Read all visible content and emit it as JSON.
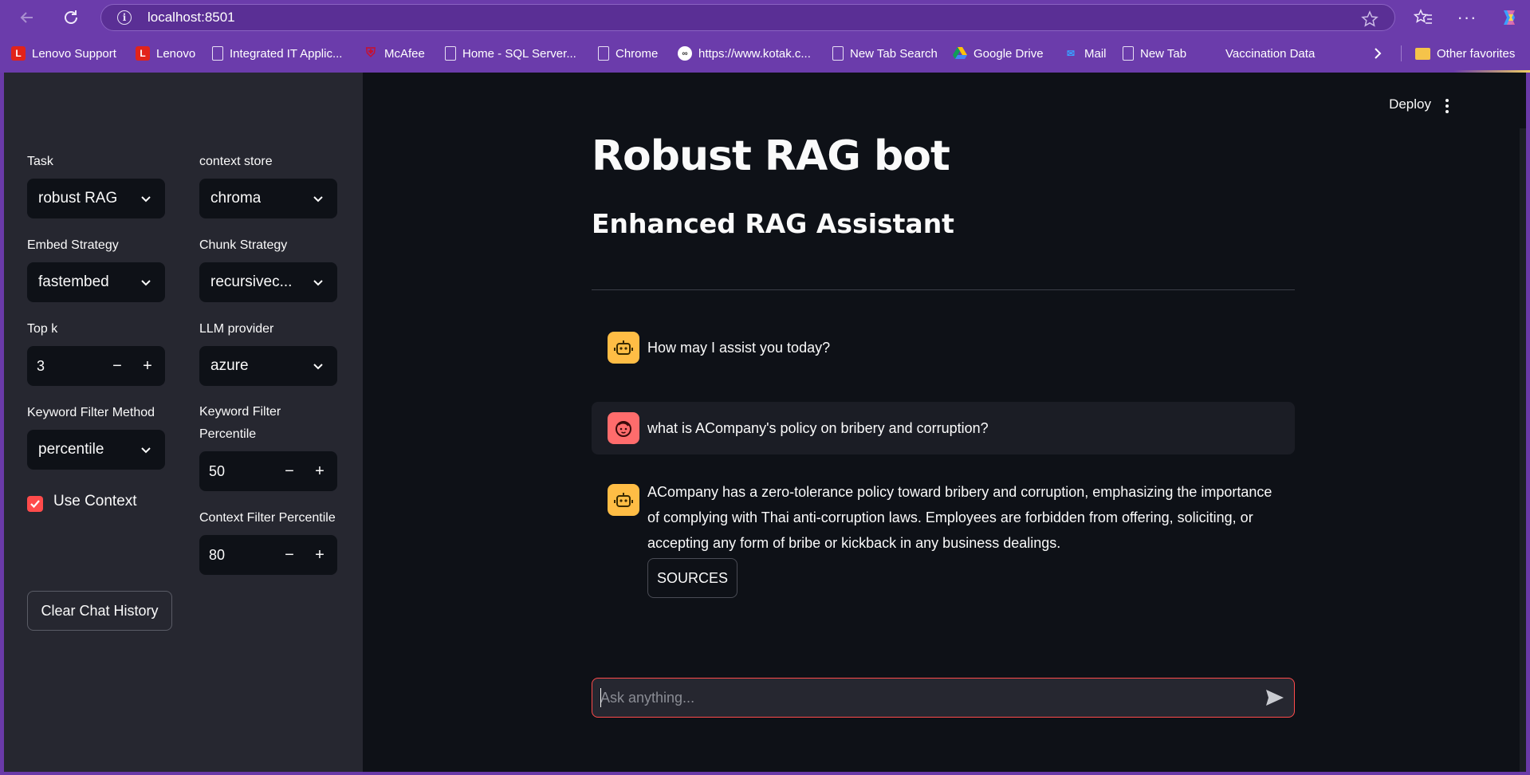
{
  "browser": {
    "url": "localhost:8501",
    "bookmarks": [
      {
        "label": "Lenovo Support",
        "icon": "lenovo-icon"
      },
      {
        "label": "Lenovo",
        "icon": "lenovo-icon"
      },
      {
        "label": "Integrated IT Applic...",
        "icon": "page-icon"
      },
      {
        "label": "McAfee",
        "icon": "mcafee-icon"
      },
      {
        "label": "Home - SQL Server...",
        "icon": "page-icon"
      },
      {
        "label": "Chrome",
        "icon": "page-icon"
      },
      {
        "label": "https://www.kotak.c...",
        "icon": "kotak-icon"
      },
      {
        "label": "New Tab Search",
        "icon": "page-icon"
      },
      {
        "label": "Google Drive",
        "icon": "google-drive-icon"
      },
      {
        "label": "Mail",
        "icon": "mail-icon"
      },
      {
        "label": "New Tab",
        "icon": "page-icon"
      },
      {
        "label": "Vaccination Data",
        "icon": "microsoft-icon"
      }
    ],
    "other_favorites": "Other favorites"
  },
  "sidebar": {
    "task": {
      "label": "Task",
      "value": "robust RAG"
    },
    "context_store": {
      "label": "context store",
      "value": "chroma"
    },
    "embed_strategy": {
      "label": "Embed Strategy",
      "value": "fastembed"
    },
    "chunk_strategy": {
      "label": "Chunk Strategy",
      "value": "recursivec..."
    },
    "top_k": {
      "label": "Top k",
      "value": "3"
    },
    "llm_provider": {
      "label": "LLM provider",
      "value": "azure"
    },
    "keyword_filter_method": {
      "label": "Keyword Filter Method",
      "value": "percentile"
    },
    "keyword_filter_percentile": {
      "label_line1": "Keyword Filter",
      "label_line2": "Percentile",
      "value": "50"
    },
    "use_context": {
      "label": "Use Context",
      "checked": true
    },
    "context_filter_percentile": {
      "label": "Context Filter Percentile",
      "value": "80"
    },
    "clear_button": "Clear Chat History"
  },
  "main": {
    "deploy": "Deploy",
    "title": "Robust RAG bot",
    "subtitle": "Enhanced RAG Assistant",
    "messages": [
      {
        "role": "assistant",
        "text": "How may I assist you today?"
      },
      {
        "role": "user",
        "text": "what is ACompany's policy on bribery and corruption?"
      },
      {
        "role": "assistant",
        "text": "ACompany has a zero-tolerance policy toward bribery and corruption, emphasizing the importance of complying with Thai anti-corruption laws. Employees are forbidden from offering, soliciting, or accepting any form of bribe or kickback in any business dealings.",
        "button": "SOURCES"
      }
    ],
    "input_placeholder": "Ask anything..."
  },
  "colors": {
    "browser_frame": "#6b3cab",
    "app_bg": "#0e1117",
    "sidebar_bg": "#262730",
    "accent": "#ff4b4b",
    "bot_avatar": "#ffbd45",
    "user_avatar": "#ff6c6c"
  }
}
